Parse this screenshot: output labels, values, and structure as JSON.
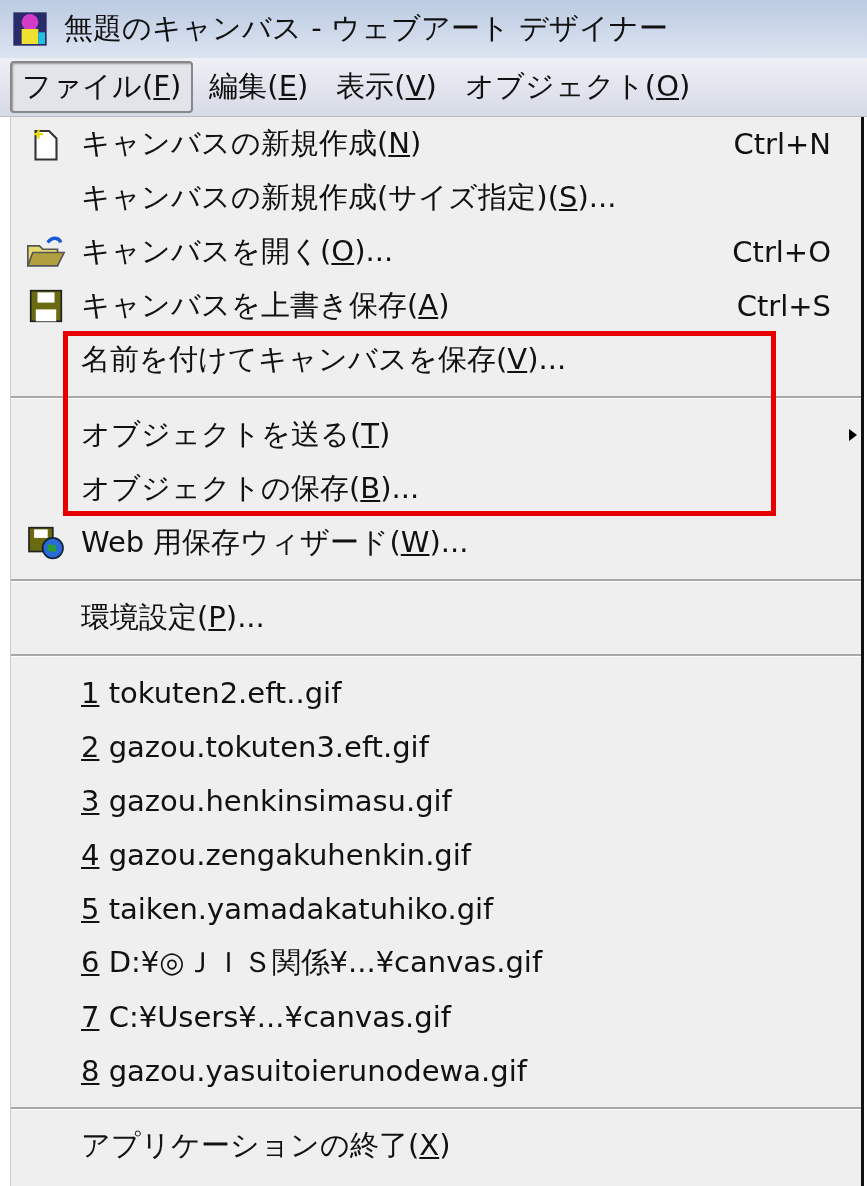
{
  "window": {
    "title": "無題のキャンバス - ウェブアート デザイナー"
  },
  "menu_bar": [
    {
      "pre": "ファイル(",
      "key": "F",
      "post": ")",
      "selected": true
    },
    {
      "pre": "編集(",
      "key": "E",
      "post": ")",
      "selected": false
    },
    {
      "pre": "表示(",
      "key": "V",
      "post": ")",
      "selected": false
    },
    {
      "pre": "オブジェクト(",
      "key": "O",
      "post": ")",
      "selected": false
    }
  ],
  "menu": [
    {
      "kind": "new",
      "pre": "キャンバスの新規作成(",
      "key": "N",
      "post": ")",
      "shortcut": "Ctrl+N",
      "submenu": false,
      "highlighted": false
    },
    {
      "kind": "item",
      "pre": "キャンバスの新規作成(サイズ指定)(",
      "key": "S",
      "post": ")...",
      "submenu": false,
      "highlighted": false
    },
    {
      "kind": "open",
      "pre": "キャンバスを開く(",
      "key": "O",
      "post": ")...",
      "shortcut": "Ctrl+O",
      "submenu": false,
      "highlighted": false
    },
    {
      "kind": "save",
      "pre": "キャンバスを上書き保存(",
      "key": "A",
      "post": ")",
      "shortcut": "Ctrl+S",
      "submenu": false,
      "highlighted": false
    },
    {
      "kind": "item",
      "pre": "名前を付けてキャンバスを保存(",
      "key": "V",
      "post": ")...",
      "submenu": false,
      "highlighted": true
    },
    {
      "kind": "separator",
      "highlighted": true
    },
    {
      "kind": "item",
      "pre": "オブジェクトを送る(",
      "key": "T",
      "post": ")",
      "submenu": true,
      "highlighted": true
    },
    {
      "kind": "item",
      "pre": "オブジェクトの保存(",
      "key": "B",
      "post": ")...",
      "submenu": false,
      "highlighted": true
    },
    {
      "kind": "websave",
      "pre": "Web 用保存ウィザード(",
      "key": "W",
      "post": ")...",
      "submenu": false,
      "highlighted": false
    },
    {
      "kind": "separator",
      "highlighted": false
    },
    {
      "kind": "item",
      "pre": "環境設定(",
      "key": "P",
      "post": ")...",
      "submenu": false,
      "highlighted": false
    },
    {
      "kind": "separator",
      "highlighted": false
    },
    {
      "kind": "item",
      "key": "1",
      "post": " tokuten2.eft..gif",
      "submenu": false,
      "highlighted": false
    },
    {
      "kind": "item",
      "key": "2",
      "post": " gazou.tokuten3.eft.gif",
      "submenu": false,
      "highlighted": false
    },
    {
      "kind": "item",
      "key": "3",
      "post": " gazou.henkinsimasu.gif",
      "submenu": false,
      "highlighted": false
    },
    {
      "kind": "item",
      "key": "4",
      "post": " gazou.zengakuhenkin.gif",
      "submenu": false,
      "highlighted": false
    },
    {
      "kind": "item",
      "key": "5",
      "post": " taiken.yamadakatuhiko.gif",
      "submenu": false,
      "highlighted": false
    },
    {
      "kind": "item",
      "key": "6",
      "post": " D:¥◎ＪＩＳ関係¥...¥canvas.gif",
      "submenu": false,
      "highlighted": false
    },
    {
      "kind": "item",
      "key": "7",
      "post": " C:¥Users¥...¥canvas.gif",
      "submenu": false,
      "highlighted": false
    },
    {
      "kind": "item",
      "key": "8",
      "post": " gazou.yasuitoierunodewa.gif",
      "submenu": false,
      "highlighted": false
    },
    {
      "kind": "separator",
      "highlighted": false
    },
    {
      "kind": "item",
      "pre": "アプリケーションの終了(",
      "key": "X",
      "post": ")",
      "submenu": false,
      "highlighted": false
    }
  ]
}
